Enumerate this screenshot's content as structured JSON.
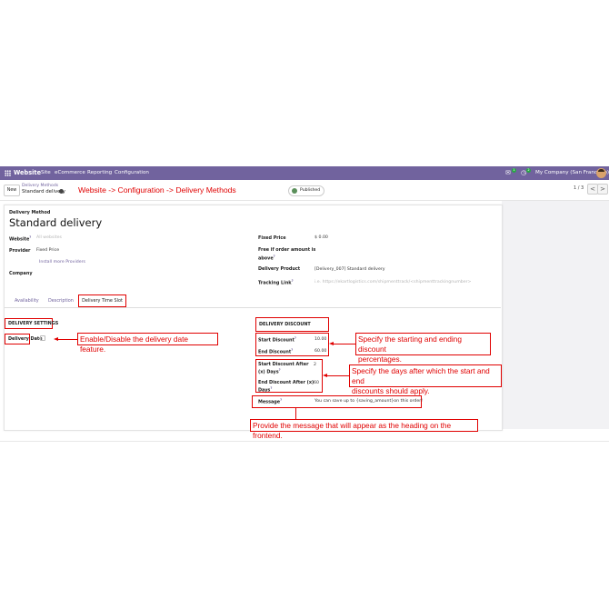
{
  "navbar": {
    "brand": "Website",
    "menu": [
      "Site",
      "eCommerce",
      "Reporting",
      "Configuration"
    ],
    "chat_badge": "1",
    "activity_badge": "2",
    "company": "My Company (San Francisco)"
  },
  "control": {
    "new_label": "New",
    "breadcrumb_parent": "Delivery Methods",
    "breadcrumb_current": "Standard delivery",
    "published": "Published",
    "pager": "1 / 3",
    "prev": "<",
    "next": ">"
  },
  "annotation_title": "Website -> Configuration -> Delivery Methods",
  "form": {
    "type_label": "Delivery Method",
    "name": "Standard delivery",
    "website_label": "Website",
    "website_placeholder": "All websites",
    "provider_label": "Provider",
    "provider_value": "Fixed Price",
    "install_providers": "Install more Providers",
    "company_label": "Company",
    "fixed_price_label": "Fixed Price",
    "fixed_price_value": "$ 0.00",
    "free_if_label_1": "Free if order amount is",
    "free_if_label_2": "above",
    "delivery_product_label": "Delivery Product",
    "delivery_product_value": "[Delivery_007] Standard delivery",
    "tracking_link_label": "Tracking Link",
    "tracking_link_placeholder": "i.e. https://ekartlogistics.com/shipmenttrack/<shipmenttrackingnumber>"
  },
  "tabs": {
    "availability": "Availability",
    "description": "Description",
    "time_slot": "Delivery Time Slot"
  },
  "settings": {
    "header": "DELIVERY SETTINGS",
    "delivery_date_label": "Delivery Date"
  },
  "discount": {
    "header": "DELIVERY DISCOUNT",
    "start_label": "Start Discount",
    "start_value": "10.00",
    "end_label": "End Discount",
    "end_value": "60.00",
    "start_after_label_1": "Start Discount After",
    "start_after_label_2": "(x) Days",
    "start_after_value": "2",
    "end_after_label_1": "End Discount After (x)",
    "end_after_label_2": "Days",
    "end_after_value": "60",
    "message_label": "Message",
    "message_value": "You can save up to {saving_amount}on this order!"
  },
  "notes": {
    "delivery_date": "Enable/Disable the delivery date feature.",
    "discount_pct_1": "Specify the starting and ending discount",
    "discount_pct_2": "percentages.",
    "days_1": "Specify the days after which the start and end",
    "days_2": "discounts should apply.",
    "message": "Provide the message that will appear as the heading on the frontend."
  },
  "colors": {
    "navbar": "#71639e",
    "annotation": "#e00000",
    "link": "#71639e"
  }
}
